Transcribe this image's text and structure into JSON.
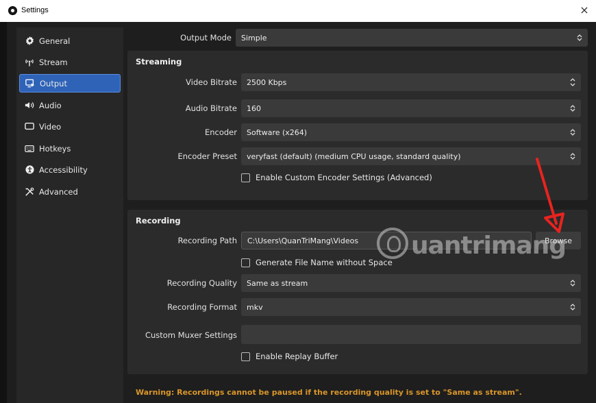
{
  "window": {
    "title": "Settings",
    "close_glyph": "×"
  },
  "sidebar": {
    "items": [
      {
        "label": "General",
        "icon": "gear-icon",
        "active": false
      },
      {
        "label": "Stream",
        "icon": "antenna-icon",
        "active": false
      },
      {
        "label": "Output",
        "icon": "output-icon",
        "active": true
      },
      {
        "label": "Audio",
        "icon": "speaker-icon",
        "active": false
      },
      {
        "label": "Video",
        "icon": "monitor-icon",
        "active": false
      },
      {
        "label": "Hotkeys",
        "icon": "keyboard-icon",
        "active": false
      },
      {
        "label": "Accessibility",
        "icon": "accessibility-icon",
        "active": false
      },
      {
        "label": "Advanced",
        "icon": "tools-icon",
        "active": false
      }
    ]
  },
  "output_mode": {
    "label": "Output Mode",
    "value": "Simple"
  },
  "streaming": {
    "title": "Streaming",
    "video_bitrate": {
      "label": "Video Bitrate",
      "value": "2500 Kbps"
    },
    "audio_bitrate": {
      "label": "Audio Bitrate",
      "value": "160"
    },
    "encoder": {
      "label": "Encoder",
      "value": "Software (x264)"
    },
    "encoder_preset": {
      "label": "Encoder Preset",
      "value": "veryfast (default) (medium CPU usage, standard quality)"
    },
    "custom_encoder_checkbox": {
      "label": "Enable Custom Encoder Settings (Advanced)",
      "checked": false
    }
  },
  "recording": {
    "title": "Recording",
    "path": {
      "label": "Recording Path",
      "value": "C:\\Users\\QuanTriMang\\Videos"
    },
    "browse_label": "Browse",
    "generate_filename_checkbox": {
      "label": "Generate File Name without Space",
      "checked": false
    },
    "quality": {
      "label": "Recording Quality",
      "value": "Same as stream"
    },
    "format": {
      "label": "Recording Format",
      "value": "mkv"
    },
    "muxer": {
      "label": "Custom Muxer Settings",
      "value": ""
    },
    "replay_buffer_checkbox": {
      "label": "Enable Replay Buffer",
      "checked": false
    }
  },
  "warning": "Warning: Recordings cannot be paused if the recording quality is set to \"Same as stream\".",
  "watermark": {
    "text": "uantrimang"
  },
  "colors": {
    "accent": "#2e63b8",
    "warning": "#d9962a",
    "arrow": "#e8231f"
  }
}
